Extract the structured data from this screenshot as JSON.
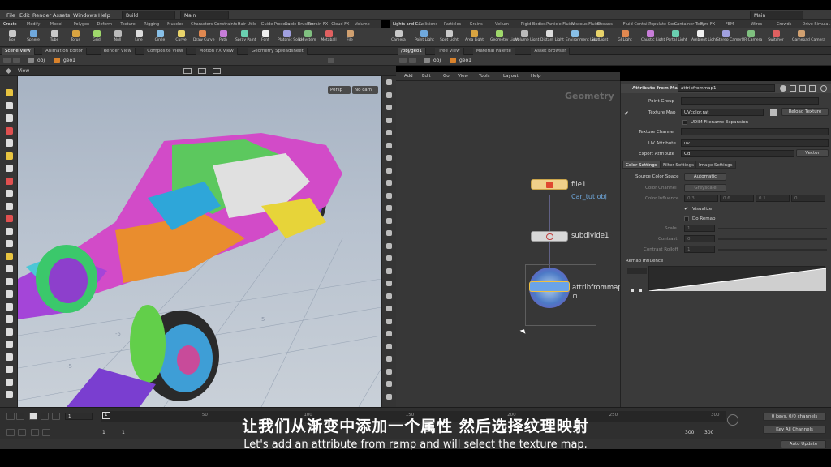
{
  "menubar": {
    "items": [
      "File",
      "Edit",
      "Render",
      "Assets",
      "Windows",
      "Help"
    ],
    "desktop_combo": "Build",
    "take_combo": "Main",
    "right_combo": "Main"
  },
  "shelf_tabs_left": [
    "Create",
    "Modify",
    "Model",
    "Polygon",
    "Deform",
    "Texture",
    "Rigging",
    "Muscles",
    "Characters",
    "Constraints",
    "Hair Utils",
    "Guide Process",
    "Guide Brushes",
    "Terrain FX",
    "Cloud FX",
    "Volume"
  ],
  "shelf_tabs_right": [
    "Lights and C...",
    "Collisions",
    "Particles",
    "Grains",
    "Vellum",
    "Rigid Bodies",
    "Particle Fluids",
    "Viscous Fluids",
    "Oceans",
    "Fluid Contai...",
    "Populate Con...",
    "Container Tools",
    "Pyro FX",
    "FEM",
    "Wires",
    "Crowds",
    "Drive Simula..."
  ],
  "tools_left": [
    "Box",
    "Sphere",
    "Tube",
    "Torus",
    "Grid",
    "Null",
    "Line",
    "Circle",
    "Curve",
    "Draw Curve",
    "Path",
    "Spray Paint",
    "Font",
    "Platonic Solids",
    "L-System",
    "Metaball",
    "File"
  ],
  "tools_right": [
    "Camera",
    "Point Light",
    "Spot Light",
    "Area Light",
    "Geometry Light",
    "Volume Light",
    "Distant Light",
    "Environment Light",
    "Sky Light",
    "GI Light",
    "Caustic Light",
    "Portal Light",
    "Ambient Light",
    "Stereo Camera",
    "VR Camera",
    "Switcher",
    "Gamepad Camera"
  ],
  "left_pane": {
    "tabs": [
      "Scene View",
      "Animation Editor",
      "Render View",
      "Composite View",
      "Motion FX View",
      "Geometry Spreadsheet"
    ],
    "path": [
      "obj",
      "geo1"
    ],
    "view_label": "View",
    "persp_button": "Persp",
    "cam_button": "No cam",
    "grid_numbers": [
      "-5",
      "5",
      "-5"
    ]
  },
  "right_pane": {
    "tabs": [
      "/obj/geo1",
      "Tree View",
      "Material Palette",
      "Asset Browser"
    ],
    "path": [
      "obj",
      "geo1"
    ],
    "menu": [
      "Add",
      "Edit",
      "Go",
      "View",
      "Tools",
      "Layout",
      "Help"
    ],
    "context_label": "Geometry",
    "nodes": [
      {
        "name": "file1",
        "sub": "Car_tut.obj"
      },
      {
        "name": "subdivide1",
        "sub": ""
      },
      {
        "name": "attribfrommap1",
        "sub": ""
      }
    ]
  },
  "params": {
    "node_type": "Attribute from Map",
    "node_name": "attribfrommap1",
    "point_group_label": "Point Group",
    "texture_map_label": "Texture Map",
    "texture_map_value": "UVcolor.rat",
    "reload_button": "Reload Texture",
    "udim_label": "UDIM Filename Expansion",
    "texture_channel_label": "Texture Channel",
    "uv_attr_label": "UV Attribute",
    "uv_attr_value": "uv",
    "export_attr_label": "Export Attribute",
    "export_attr_value": "Cd",
    "export_type": "Vector",
    "tabs": [
      "Color Settings",
      "Filter Settings",
      "Image Settings"
    ],
    "source_color_space_label": "Source Color Space",
    "source_color_space_value": "Automatic",
    "color_channel_label": "Color Channel",
    "color_channel_value": "Greyscale",
    "color_influence_label": "Color Influence",
    "color_influence_values": [
      "0.3",
      "0.6",
      "0.1",
      "0"
    ],
    "visualize_label": "Visualize",
    "do_remap_label": "Do Remap",
    "scale_label": "Scale",
    "scale_value": "1",
    "contrast_label": "Contrast",
    "contrast_value": "0",
    "contrast_rolloff_label": "Contrast Rolloff",
    "contrast_rolloff_value": "1",
    "remap_influence_label": "Remap Influence"
  },
  "timeline": {
    "frame_current": "1",
    "start": "1",
    "start2": "1",
    "end": "300",
    "end2": "300",
    "ticks": [
      "1",
      "50",
      "100",
      "150",
      "200",
      "250",
      "300"
    ],
    "keys_label": "0 keys, 0/0 channels",
    "key_all": "Key All Channels",
    "auto_update": "Auto Update"
  },
  "subtitles": {
    "chinese": "让我们从渐变中添加一个属性 然后选择纹理映射",
    "english": "Let's add an attribute from ramp and will select the texture map."
  }
}
